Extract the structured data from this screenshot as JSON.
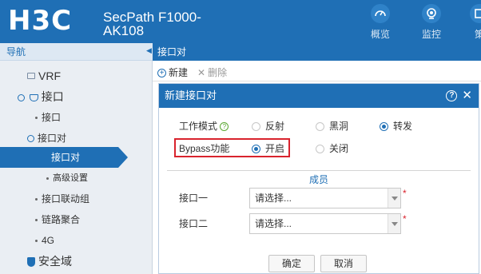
{
  "header": {
    "logo": "H3C",
    "product": "SecPath F1000-AK108",
    "nav": [
      {
        "label": "概览",
        "icon": "gauge-icon"
      },
      {
        "label": "监控",
        "icon": "camera-icon"
      },
      {
        "label": "策",
        "icon": "policy-icon"
      }
    ]
  },
  "sidebar": {
    "title": "导航",
    "items": [
      {
        "label": "VRF",
        "level": 1
      },
      {
        "label": "接口",
        "level": 1
      },
      {
        "label": "接口",
        "level": 2
      },
      {
        "label": "接口对",
        "level": 2
      },
      {
        "label": "接口对",
        "level": 3,
        "active": true
      },
      {
        "label": "高级设置",
        "level": 3
      },
      {
        "label": "接口联动组",
        "level": 2
      },
      {
        "label": "链路聚合",
        "level": 2
      },
      {
        "label": "4G",
        "level": 2
      },
      {
        "label": "安全域",
        "level": 1
      }
    ]
  },
  "tab": {
    "label": "接口对"
  },
  "toolbar": {
    "new_label": "新建",
    "delete_label": "删除"
  },
  "dialog": {
    "title": "新建接口对",
    "mode_label": "工作模式",
    "mode_options": [
      "反射",
      "黑洞",
      "转发"
    ],
    "mode_selected": "转发",
    "bypass_label": "Bypass功能",
    "bypass_options": [
      "开启",
      "关闭"
    ],
    "bypass_selected": "开启",
    "members_title": "成员",
    "if1_label": "接口一",
    "if2_label": "接口二",
    "select_placeholder": "请选择...",
    "ok_label": "确定",
    "cancel_label": "取消"
  },
  "colors": {
    "primary": "#1f6fb5",
    "highlight": "#d9232d"
  }
}
